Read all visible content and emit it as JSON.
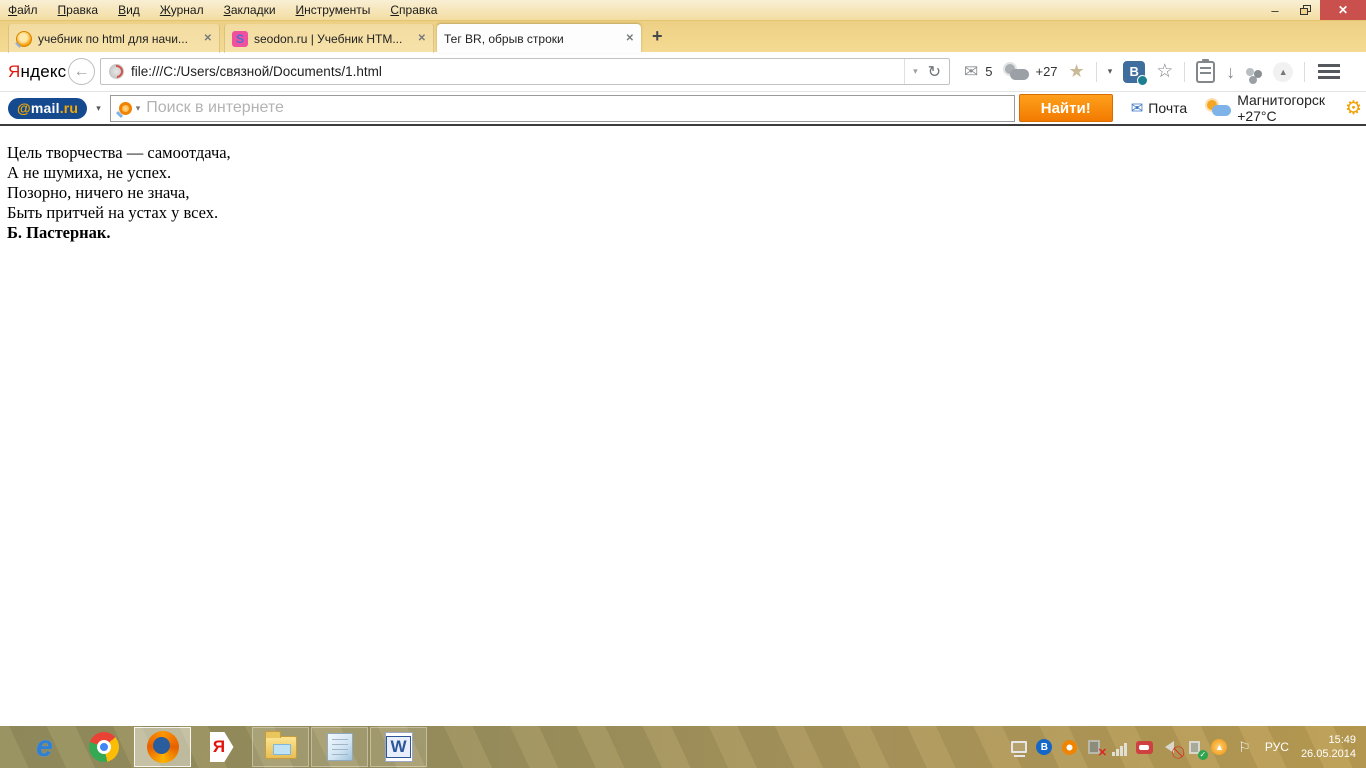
{
  "window": {
    "minimize_glyph": "–",
    "close_glyph": "✕"
  },
  "menu_bar": {
    "items": [
      {
        "first": "Ф",
        "rest": "айл"
      },
      {
        "first": "П",
        "rest": "равка"
      },
      {
        "first": "В",
        "rest": "ид"
      },
      {
        "first": "Ж",
        "rest": "урнал"
      },
      {
        "first": "З",
        "rest": "акладки"
      },
      {
        "first": "И",
        "rest": "нструменты"
      },
      {
        "first": "С",
        "rest": "правка"
      }
    ]
  },
  "tab_bar": {
    "tabs": [
      {
        "title": "учебник по html для начи...",
        "favicon": "magnifier-favicon",
        "close_glyph": "✕",
        "active": false
      },
      {
        "title": "seodon.ru | Учебник HTM...",
        "favicon": "seodon-s-favicon",
        "favicon_letter": "S",
        "close_glyph": "✕",
        "active": false
      },
      {
        "title": "Тег BR, обрыв строки",
        "close_glyph": "✕",
        "active": true
      }
    ],
    "new_tab_glyph": "+"
  },
  "nav": {
    "yandex_first": "Я",
    "yandex_rest": "ндекс",
    "back_glyph": "←",
    "url": "file:///C:/Users/связной/Documents/1.html",
    "url_dropdown_glyph": "▾",
    "reload_glyph": "↻",
    "mail_envelope_glyph": "✉",
    "mail_badge": "5",
    "weather_temp": "+27",
    "bookmark_star_glyph": "★",
    "caret_glyph": "▾",
    "vk_letter": "B",
    "star_outline_glyph": "☆",
    "download_glyph": "↓",
    "chevron_up_glyph": "▲"
  },
  "mailru_bar": {
    "logo_at": "@",
    "logo_mail": "mail",
    "logo_ru": ".ru",
    "logo_caret": "▾",
    "search_caret": "▾",
    "search_placeholder": "Поиск в интернете",
    "find_button": "Найти!",
    "mail_envelope_glyph": "✉",
    "mail_label": "Почта",
    "weather_label": "Магнитогорск +27°C",
    "gear_glyph": "⚙"
  },
  "page": {
    "poem_lines": [
      "Цель творчества — самоотдача,",
      "А не шумиха, не успех.",
      "Позорно, ничего не знача,",
      "Быть притчей на устах у всех."
    ],
    "author": "Б. Пастернак."
  },
  "taskbar": {
    "apps": [
      {
        "name": "internet-explorer",
        "letter": "e",
        "state": "pinned"
      },
      {
        "name": "chrome",
        "state": "pinned"
      },
      {
        "name": "firefox",
        "state": "active"
      },
      {
        "name": "yandex-browser",
        "letter": "Я",
        "state": "pinned"
      },
      {
        "name": "file-explorer",
        "state": "open"
      },
      {
        "name": "notepad",
        "state": "open"
      },
      {
        "name": "word",
        "letter": "W",
        "state": "open"
      }
    ],
    "tray": {
      "lang": "РУС",
      "time": "15:49",
      "date": "26.05.2014",
      "flag_glyph": "⚐",
      "update_glyph": "▲"
    }
  },
  "colors": {
    "theme_gold": "#f2d484",
    "close_red": "#c9504c",
    "accent_orange": "#f27a00",
    "mailru_navy": "#164a8f",
    "yandex_red": "#e0160e",
    "vk_blue": "#3f6d9e",
    "taskbar_olive": "#8f8a5c",
    "taskbar_gold": "#b89a51"
  }
}
